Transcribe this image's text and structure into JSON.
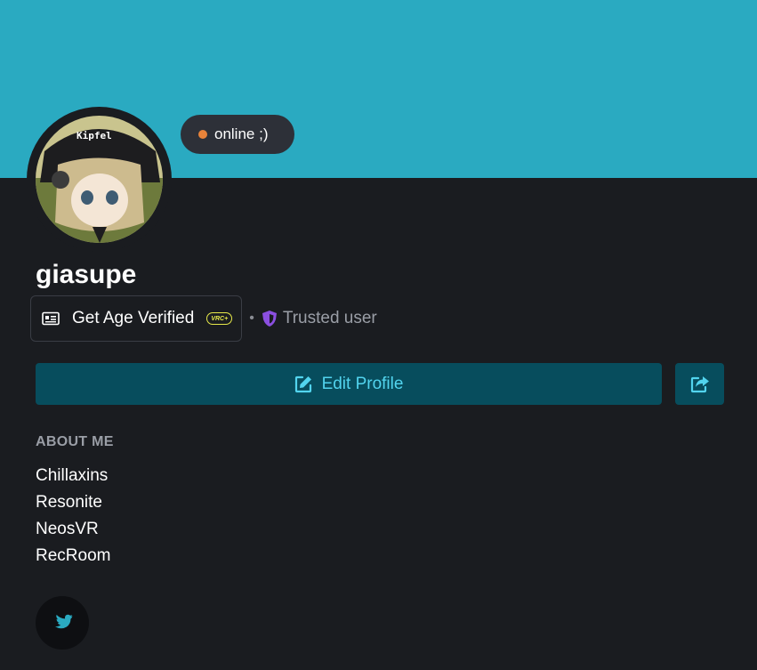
{
  "profile": {
    "avatar_caption": "Kipfel",
    "status_text": "online ;)",
    "status_color": "#e8833a",
    "username": "giasupe"
  },
  "badges": {
    "age_verify_label": "Get Age Verified",
    "vrc_plus_label": "VRC+",
    "separator": "•",
    "trust_label": "Trusted user",
    "trust_color": "#8b4fe0"
  },
  "actions": {
    "edit_label": "Edit Profile",
    "share_icon": "share-icon"
  },
  "about": {
    "heading": "ABOUT ME",
    "lines": [
      "Chillaxins",
      "Resonite",
      "NeosVR",
      "RecRoom"
    ]
  },
  "social": {
    "icon": "twitter-icon"
  },
  "colors": {
    "banner": "#2aaac1",
    "background": "#1a1c20",
    "accent": "#52d4ee",
    "button": "#074d5d"
  }
}
